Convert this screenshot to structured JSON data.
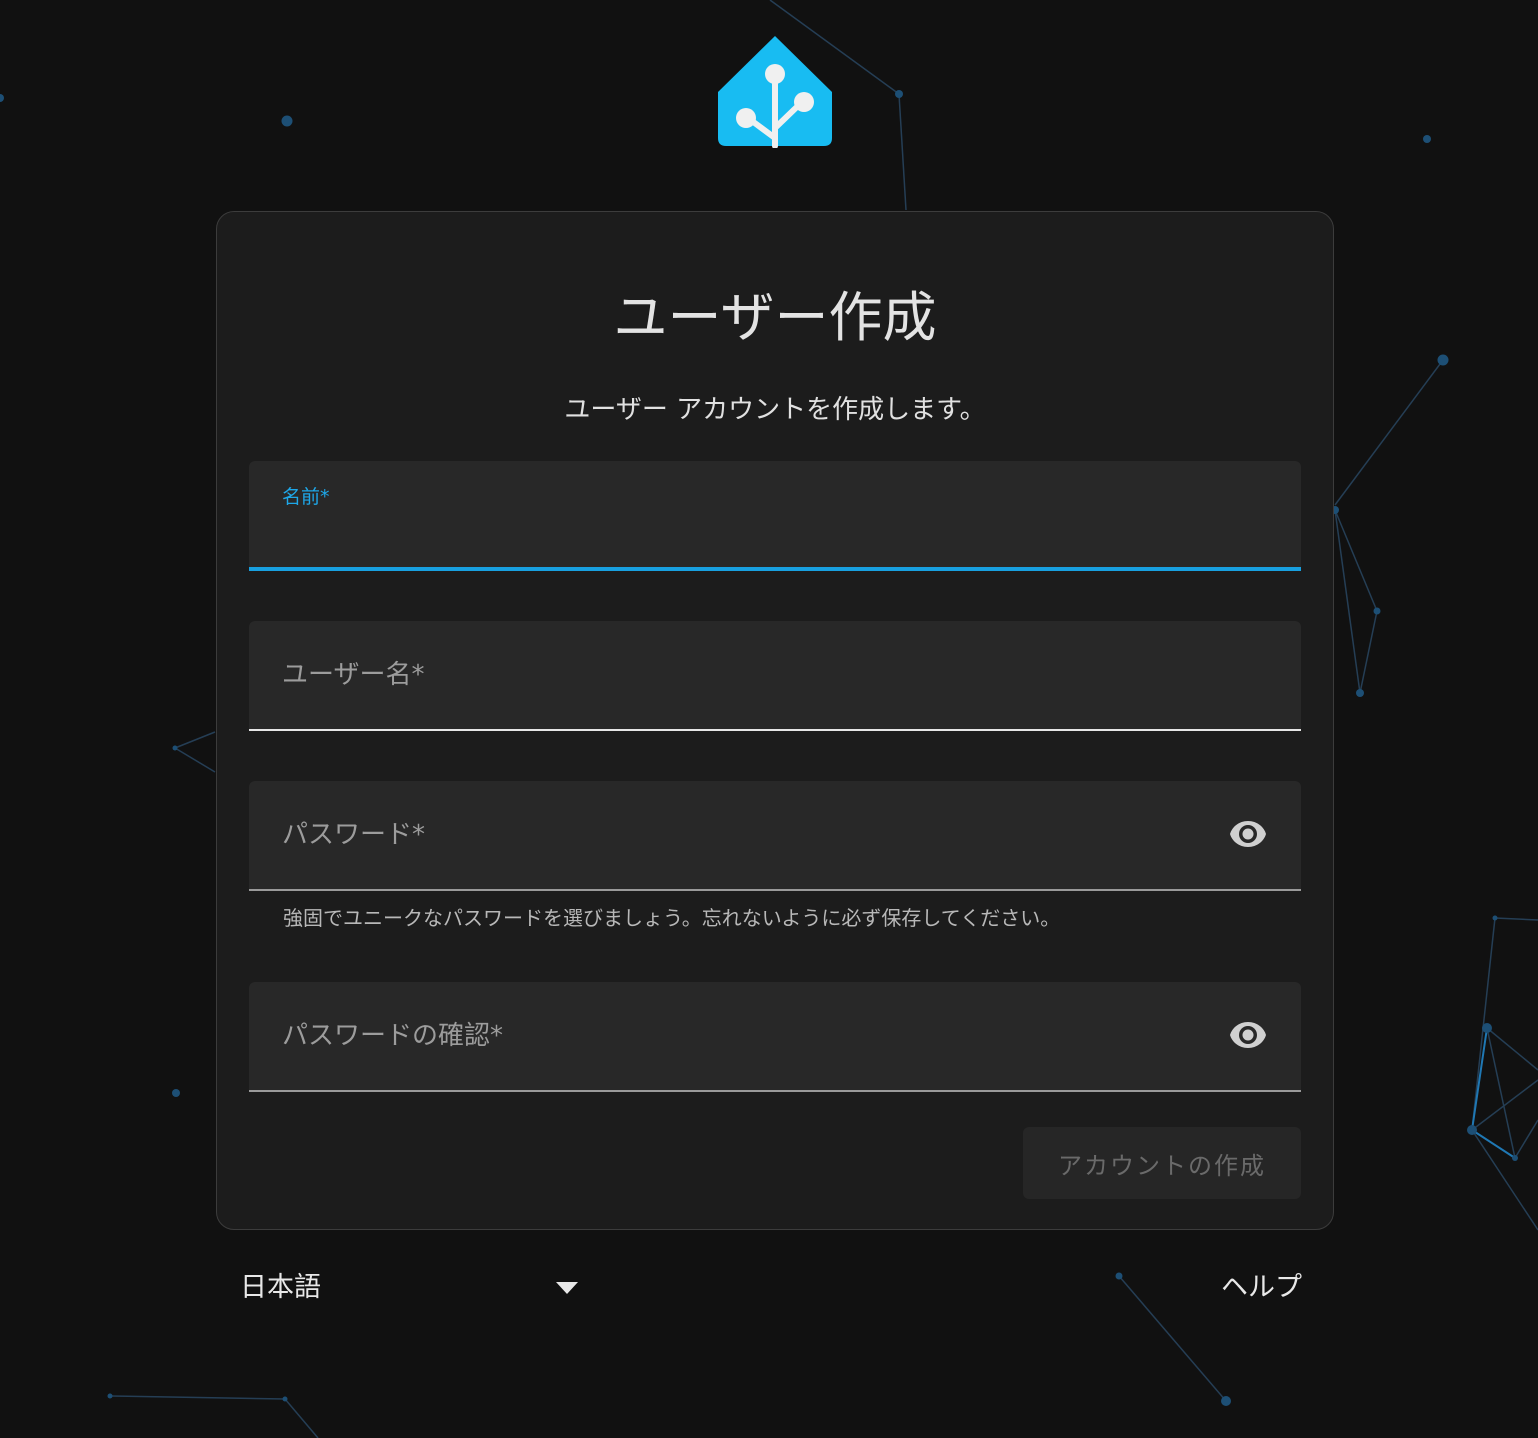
{
  "brand": {
    "logo_icon": "home-assistant-logo-icon",
    "accent_color": "#18a0e0",
    "logo_color": "#18bcf2"
  },
  "card": {
    "title": "ユーザー作成",
    "subtitle": "ユーザー アカウントを作成します。"
  },
  "form": {
    "name_label": "名前*",
    "name_value": "",
    "username_label": "ユーザー名*",
    "username_value": "",
    "password_label": "パスワード*",
    "password_value": "",
    "password_helper": "強固でユニークなパスワードを選びましょう。忘れないように必ず保存してください。",
    "confirm_label": "パスワードの確認*",
    "confirm_value": "",
    "submit_label": "アカウントの作成"
  },
  "footer": {
    "language_selected": "日本語",
    "help_label": "ヘルプ"
  },
  "icons": {
    "password_toggle": "eye-icon",
    "language_dropdown": "caret-down-icon"
  }
}
